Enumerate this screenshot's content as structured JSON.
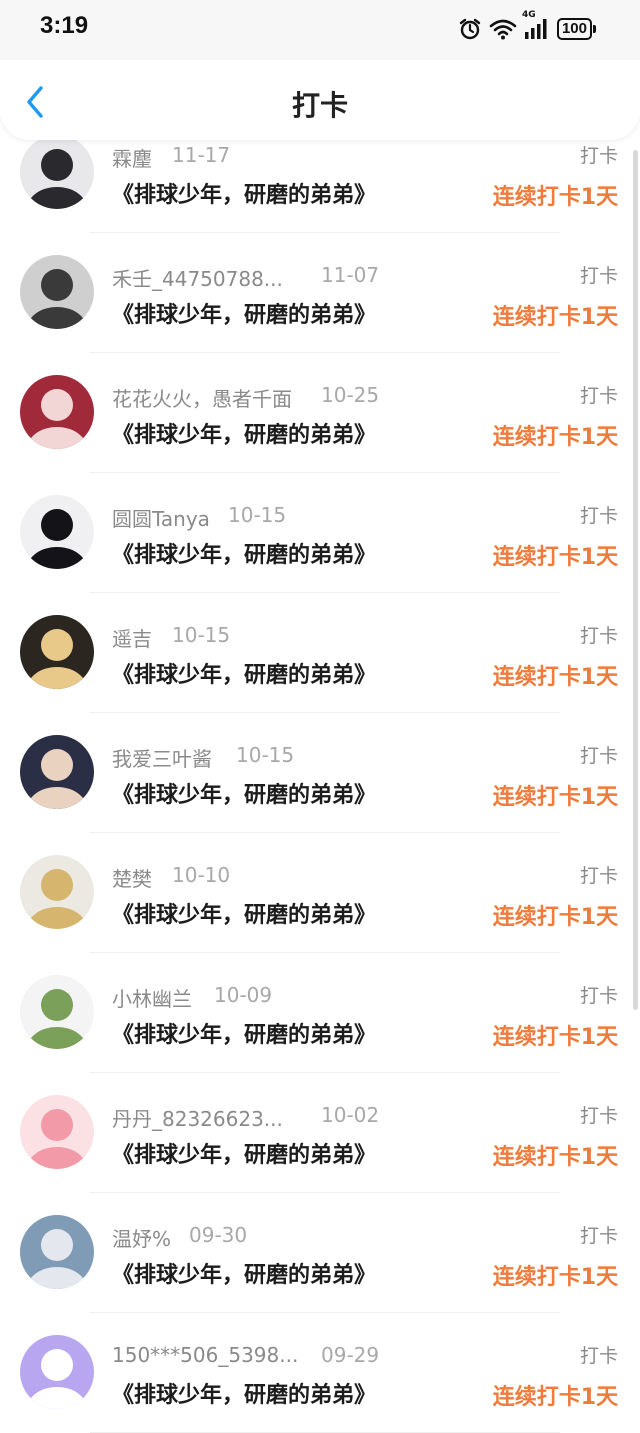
{
  "status_bar": {
    "time": "3:19",
    "network": "4G",
    "battery": "100"
  },
  "header": {
    "title": "打卡"
  },
  "items": [
    {
      "username": "霖麈",
      "date": "11-17",
      "book": "《排球少年，研磨的弟弟》",
      "label": "打卡",
      "streak": "连续打卡1天",
      "avatar_colors": [
        "#e8e8ea",
        "#2a2a2e"
      ]
    },
    {
      "username": "禾壬_44750788...",
      "date": "11-07",
      "book": "《排球少年，研磨的弟弟》",
      "label": "打卡",
      "streak": "连续打卡1天",
      "avatar_colors": [
        "#cfcfcf",
        "#3a3a3a"
      ]
    },
    {
      "username": "花花火火，愚者千面",
      "date": "10-25",
      "book": "《排球少年，研磨的弟弟》",
      "label": "打卡",
      "streak": "连续打卡1天",
      "avatar_colors": [
        "#a12a3a",
        "#f2d6d6"
      ]
    },
    {
      "username": "圆圆Tanya",
      "date": "10-15",
      "book": "《排球少年，研磨的弟弟》",
      "label": "打卡",
      "streak": "连续打卡1天",
      "avatar_colors": [
        "#f0f0f2",
        "#141418"
      ]
    },
    {
      "username": "遥吉",
      "date": "10-15",
      "book": "《排球少年，研磨的弟弟》",
      "label": "打卡",
      "streak": "连续打卡1天",
      "avatar_colors": [
        "#2b2620",
        "#e8c98a"
      ]
    },
    {
      "username": "我爱三叶酱",
      "date": "10-15",
      "book": "《排球少年，研磨的弟弟》",
      "label": "打卡",
      "streak": "连续打卡1天",
      "avatar_colors": [
        "#2a2f45",
        "#e9d2c0"
      ]
    },
    {
      "username": "楚樊",
      "date": "10-10",
      "book": "《排球少年，研磨的弟弟》",
      "label": "打卡",
      "streak": "连续打卡1天",
      "avatar_colors": [
        "#ece9e2",
        "#d6b56e"
      ]
    },
    {
      "username": "小林幽兰",
      "date": "10-09",
      "book": "《排球少年，研磨的弟弟》",
      "label": "打卡",
      "streak": "连续打卡1天",
      "avatar_colors": [
        "#f4f4f4",
        "#7aa05a"
      ]
    },
    {
      "username": "丹丹_82326623...",
      "date": "10-02",
      "book": "《排球少年，研磨的弟弟》",
      "label": "打卡",
      "streak": "连续打卡1天",
      "avatar_colors": [
        "#fbe1e4",
        "#f29aa8"
      ]
    },
    {
      "username": "温妤%",
      "date": "09-30",
      "book": "《排球少年，研磨的弟弟》",
      "label": "打卡",
      "streak": "连续打卡1天",
      "avatar_colors": [
        "#7f9bb5",
        "#e4e8ee"
      ]
    },
    {
      "username": "150***506_5398...",
      "date": "09-29",
      "book": "《排球少年，研磨的弟弟》",
      "label": "打卡",
      "streak": "连续打卡1天",
      "avatar_colors": [
        "#b9a6f0",
        "#ffffff"
      ]
    }
  ],
  "colors": {
    "accent": "#f07b3a",
    "back_arrow": "#1e9bf0",
    "muted_text": "#8a8a8a"
  }
}
